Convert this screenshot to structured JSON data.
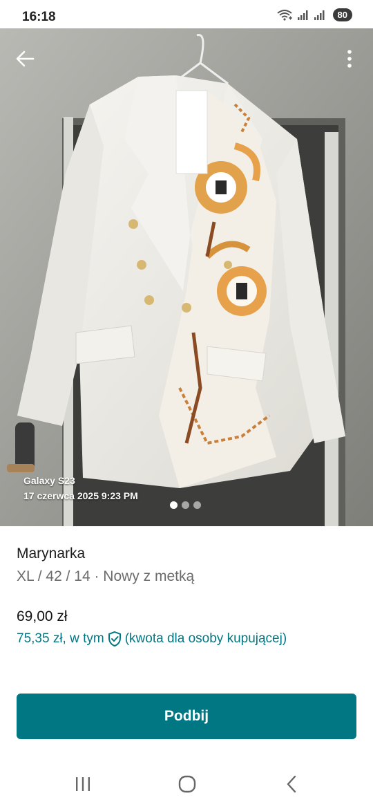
{
  "status_bar": {
    "time": "16:18",
    "battery": "80",
    "icons": [
      "wifi-calling-icon",
      "signal-icon",
      "signal-icon-2"
    ]
  },
  "photo": {
    "caption_device": "Galaxy S23",
    "caption_date": "17 czerwca 2025 9:23 PM",
    "slide_count": 3,
    "active_slide": 1
  },
  "listing": {
    "title": "Marynarka",
    "details": "XL / 42 / 14 · Nowy z metką",
    "price": "69,00 zł",
    "total_price_prefix": "75,35 zł, w tym",
    "total_price_suffix": "(kwota dla osoby kupującej)"
  },
  "actions": {
    "bump_label": "Podbij"
  },
  "colors": {
    "accent": "#007782",
    "text": "#1c1c1c",
    "muted": "#6b6b6b"
  }
}
